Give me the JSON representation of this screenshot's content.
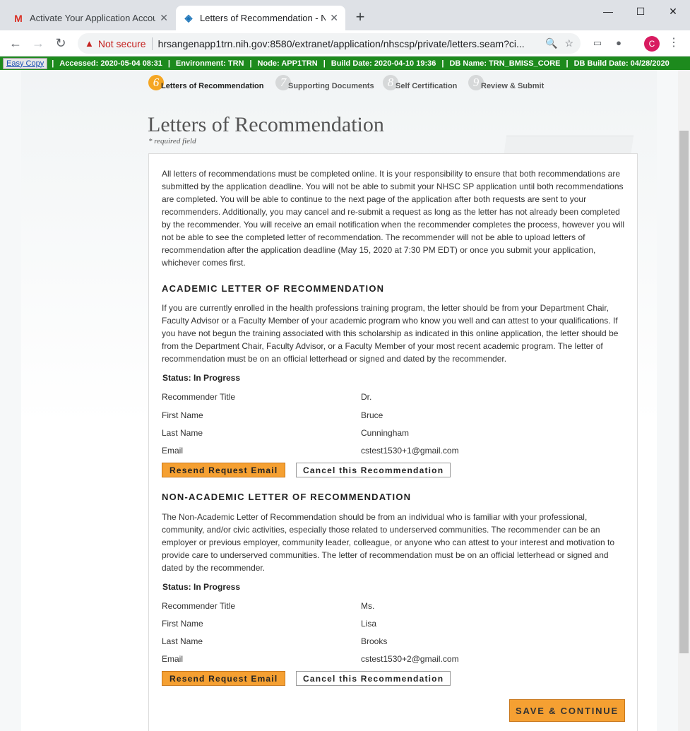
{
  "browser": {
    "tabs": [
      {
        "title": "Activate Your Application Account",
        "favicon": "M",
        "favicon_color": "#d93025"
      },
      {
        "title": "Letters of Recommendation - NHSC",
        "favicon": "◈",
        "favicon_color": "#1a73b8"
      }
    ],
    "new_tab": "+",
    "window": {
      "minimize": "—",
      "maximize": "☐",
      "close": "✕"
    },
    "nav": {
      "back": "←",
      "forward": "→",
      "reload": "↻"
    },
    "omnibox": {
      "warning_icon": "▲",
      "security": "Not secure",
      "url": "hrsangenapp1trn.nih.gov:8580/extranet/application/nhscsp/private/letters.seam?ci...",
      "zoom_icon": "🔍",
      "star_icon": "☆"
    },
    "avatar_initial": "C",
    "menu": "⋮"
  },
  "envbar": {
    "easy_copy": "Easy Copy",
    "items": [
      "|",
      "Accessed: 2020-05-04 08:31",
      "|",
      "Environment: TRN",
      "|",
      "Node: APP1TRN",
      "|",
      "Build Date: 2020-04-10 19:36",
      "|",
      "DB Name: TRN_BMISS_CORE",
      "|",
      "DB Build Date: 04/28/2020"
    ]
  },
  "steps": [
    {
      "num": "6",
      "label": "Letters of Recommendation",
      "state": "active"
    },
    {
      "num": "7",
      "label": "Supporting Documents",
      "state": "pending"
    },
    {
      "num": "8",
      "label": "Self Certification",
      "state": "pending"
    },
    {
      "num": "9",
      "label": "Review & Submit",
      "state": "pending"
    }
  ],
  "page": {
    "title": "Letters of Recommendation",
    "required_note": "* required field",
    "intro": "All letters of recommendations must be completed online. It is your responsibility to ensure that both recommendations are submitted by the application deadline. You will not be able to submit your NHSC SP application until both recommendations are completed. You will be able to continue to the next page of the application after both requests are sent to your recommenders. Additionally, you may cancel and re-submit a request as long as the letter has not already been completed by the recommender. You will receive an email notification when the recommender completes the process, however you will not be able to see the completed letter of recommendation. The recommender will not be able to upload letters of recommendation after the application deadline (May 15, 2020 at 7:30 PM EDT) or once you submit your application, whichever comes first."
  },
  "academic": {
    "heading": "ACADEMIC LETTER OF RECOMMENDATION",
    "description": "If you are currently enrolled in the health professions training program, the letter should be from your Department Chair, Faculty Advisor or a Faculty Member of your academic program who know you well and can attest to your qualifications. If you have not begun the training associated with this scholarship as indicated in this online application, the letter should be from the Department Chair, Faculty Advisor, or a Faculty Member of your most recent academic program. The letter of recommendation must be on an official letterhead or signed and dated by the recommender.",
    "status": "Status: In Progress",
    "fields": [
      {
        "label": "Recommender Title",
        "value": "Dr."
      },
      {
        "label": "First Name",
        "value": "Bruce"
      },
      {
        "label": "Last Name",
        "value": "Cunningham"
      },
      {
        "label": "Email",
        "value": "cstest1530+1@gmail.com"
      }
    ],
    "resend_label": "Resend Request Email",
    "cancel_label": "Cancel this Recommendation"
  },
  "nonacademic": {
    "heading": "NON-ACADEMIC LETTER OF RECOMMENDATION",
    "description": "The Non-Academic Letter of Recommendation should be from an individual who is familiar with your professional, community, and/or civic activities, especially those related to underserved communities. The recommender can be an employer or previous employer, community leader, colleague, or anyone who can attest to your interest and motivation to provide care to underserved communities. The letter of recommendation must be on an official letterhead or signed and dated by the recommender.",
    "status": "Status: In Progress",
    "fields": [
      {
        "label": "Recommender Title",
        "value": "Ms."
      },
      {
        "label": "First Name",
        "value": "Lisa"
      },
      {
        "label": "Last Name",
        "value": "Brooks"
      },
      {
        "label": "Email",
        "value": "cstest1530+2@gmail.com"
      }
    ],
    "resend_label": "Resend Request Email",
    "cancel_label": "Cancel this Recommendation"
  },
  "save_label": "SAVE & CONTINUE"
}
